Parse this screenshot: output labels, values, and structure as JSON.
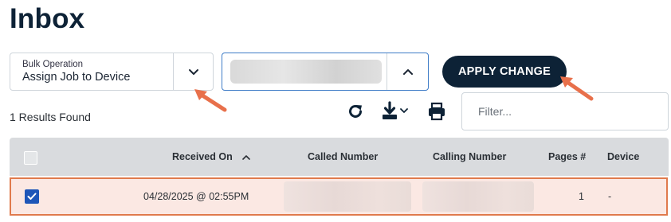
{
  "page": {
    "title": "Inbox"
  },
  "bulk_operation": {
    "label": "Bulk Operation",
    "value": "Assign Job to Device",
    "icon": "chevron-down-icon"
  },
  "value_select": {
    "value": "",
    "icon": "chevron-up-icon",
    "border_color": "#3f7cc7"
  },
  "apply_button": {
    "label": "APPLY CHANGE",
    "color": "#0d2236"
  },
  "results": {
    "count_text": "1 Results Found"
  },
  "toolbar": {
    "icons": [
      "refresh-icon",
      "download-icon",
      "print-icon"
    ]
  },
  "filter": {
    "placeholder": "Filter...",
    "value": ""
  },
  "table": {
    "columns": [
      {
        "key": "received_on",
        "label": "Received On",
        "sort": "ascending"
      },
      {
        "key": "called_number",
        "label": "Called Number"
      },
      {
        "key": "calling_number",
        "label": "Calling Number"
      },
      {
        "key": "pages",
        "label": "Pages #"
      },
      {
        "key": "device",
        "label": "Device"
      }
    ],
    "rows": [
      {
        "selected": true,
        "received_on": "04/28/2025 @ 02:55PM",
        "called_number": "",
        "calling_number": "",
        "pages": "1",
        "device": "-"
      }
    ]
  },
  "annotations": {
    "arrow_color": "#e8704b",
    "highlight_color": "#e07a4c"
  }
}
